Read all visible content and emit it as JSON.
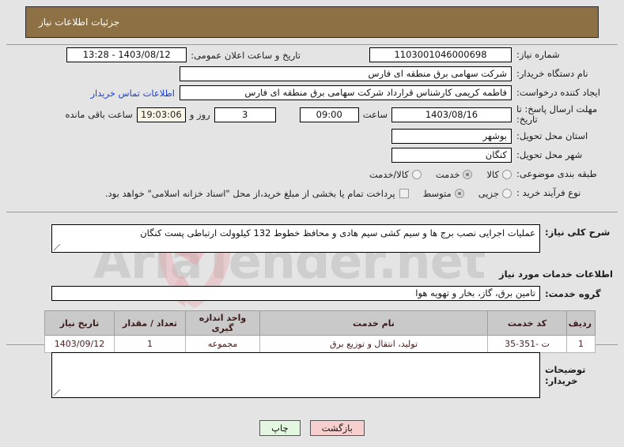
{
  "header": {
    "title": "جزئیات اطلاعات نیاز",
    "bg_color": "#8d7043"
  },
  "form": {
    "need_number_label": "شماره نیاز:",
    "need_number_value": "1103001046000698",
    "announce_label": "تاریخ و ساعت اعلان عمومی:",
    "announce_value": "1403/08/12 - 13:28",
    "buyer_org_label": "نام دستگاه خریدار:",
    "buyer_org_value": "شرکت سهامی برق منطقه ای فارس",
    "creator_label": "ایجاد کننده درخواست:",
    "creator_value": "فاطمه کریمی کارشناس قرارداد شرکت سهامی برق منطقه ای فارس",
    "contact_link": "اطلاعات تماس خریدار",
    "deadline_label": "مهلت ارسال پاسخ: تا تاریخ:",
    "deadline_date": "1403/08/16",
    "deadline_time_label": "ساعت",
    "deadline_time": "09:00",
    "remaining_days": "3",
    "remaining_days_label": "روز و",
    "remaining_clock": "19:03:06",
    "remaining_suffix": "ساعت باقی مانده",
    "province_label": "استان محل تحویل:",
    "province_value": "بوشهر",
    "city_label": "شهر محل تحویل:",
    "city_value": "کنگان",
    "category_label": "طبقه بندی موضوعی:",
    "category_options": [
      {
        "label": "کالا",
        "selected": false
      },
      {
        "label": "خدمت",
        "selected": true
      },
      {
        "label": "کالا/خدمت",
        "selected": false
      }
    ],
    "process_label": "نوع فرآیند خرید :",
    "process_options": [
      {
        "label": "جزیی",
        "selected": false
      },
      {
        "label": "متوسط",
        "selected": true
      }
    ],
    "treasury_checkbox_checked": false,
    "treasury_text": "پرداخت تمام یا بخشی از مبلغ خرید،از محل \"اسناد خزانه اسلامی\" خواهد بود."
  },
  "description": {
    "label": "شرح کلی نیاز:",
    "value": "عملیات اجرایی نصب برج ها و سیم کشی سیم هادی و محافظ خطوط 132 کیلوولت ارتباطی پست کنگان"
  },
  "services_section": {
    "heading": "اطلاعات خدمات مورد نیاز",
    "group_label": "گروه خدمت:",
    "group_value": "تامین برق، گاز، بخار و تهویه هوا",
    "columns": [
      "ردیف",
      "کد خدمت",
      "نام خدمت",
      "واحد اندازه گیری",
      "تعداد / مقدار",
      "تاریخ نیاز"
    ],
    "rows": [
      {
        "index": "1",
        "code": "ت -351-35",
        "name": "تولید، انتقال و توزیع برق",
        "unit": "مجموعه",
        "quantity": "1",
        "need_date": "1403/09/12"
      }
    ]
  },
  "buyer_notes": {
    "label": "توضیحات خریدار:",
    "value": ""
  },
  "buttons": {
    "back": "بازگشت",
    "print": "چاپ"
  },
  "watermark": {
    "text": "AriaTender.net"
  }
}
